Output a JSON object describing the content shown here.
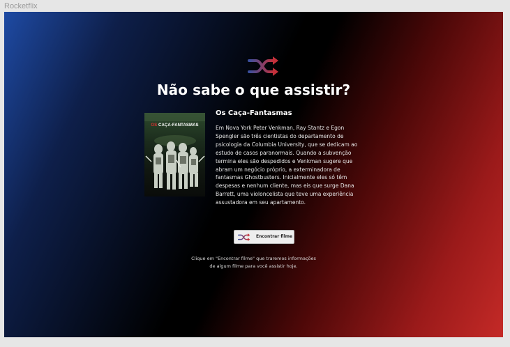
{
  "window": {
    "title": "Rocketflix"
  },
  "hero": {
    "icon": "shuffle-icon",
    "headline": "Não sabe o que assistir?"
  },
  "movie": {
    "title": "Os Caça-Fantasmas",
    "poster_title_prefix": "OS",
    "poster_title_main": "CAÇA-FANTASMAS",
    "description": "Em Nova York Peter Venkman, Ray Stantz e Egon Spengler são três cientistas do departamento de psicologia da Columbia University, que se dedicam ao estudo de casos paranormais. Quando a subvenção termina eles são despedidos e Venkman sugere que abram um negócio próprio, a exterminadora de fantasmas Ghostbusters. Inicialmente eles só têm despesas e nenhum cliente, mas eis que surge Dana Barrett, uma violoncelista que teve uma experiência assustadora em seu apartamento."
  },
  "action": {
    "button_label": "Encontrar filme",
    "button_icon": "shuffle-icon"
  },
  "hint": {
    "line1": "Clique em \"Encontrar filme\" que traremos informações",
    "line2": "de algum filme para você assistir hoje."
  },
  "colors": {
    "gradient_left": "#1e4aa3",
    "gradient_center": "#000000",
    "gradient_right": "#c42a27"
  }
}
